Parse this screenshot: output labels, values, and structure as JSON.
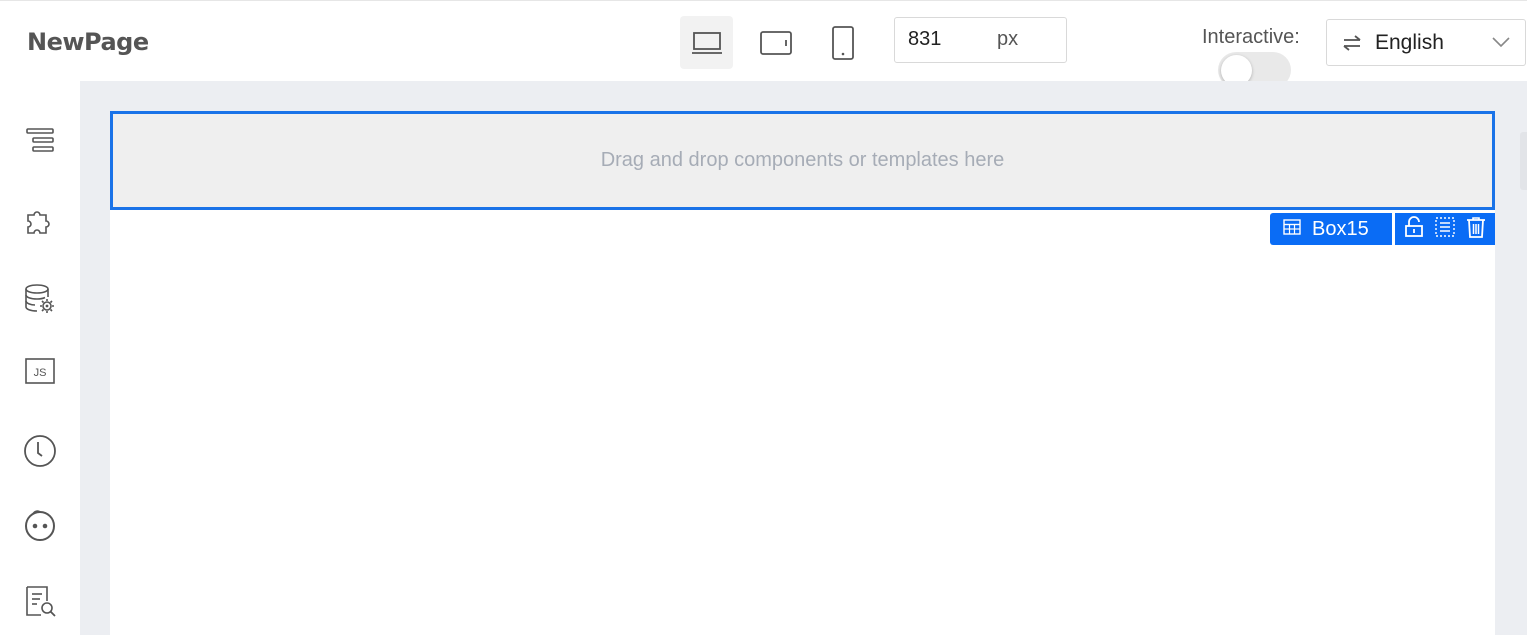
{
  "header": {
    "title": "NewPage",
    "device_modes": [
      {
        "name": "desktop",
        "icon": "laptop-icon",
        "active": true
      },
      {
        "name": "tablet",
        "icon": "tablet-icon",
        "active": false
      },
      {
        "name": "mobile",
        "icon": "phone-icon",
        "active": false
      }
    ],
    "canvas_width": {
      "value": "831",
      "unit": "px"
    },
    "interactive": {
      "label": "Interactive:",
      "enabled": false
    },
    "language": {
      "icon": "swap-icon",
      "value": "English"
    }
  },
  "sidebar": {
    "items": [
      {
        "name": "outline",
        "icon": "outline-icon"
      },
      {
        "name": "components",
        "icon": "puzzle-icon"
      },
      {
        "name": "data-source",
        "icon": "database-settings-icon"
      },
      {
        "name": "javascript",
        "icon": "js-icon"
      },
      {
        "name": "history",
        "icon": "clock-icon"
      },
      {
        "name": "ai-assistant",
        "icon": "robot-face-icon"
      },
      {
        "name": "search-code",
        "icon": "document-search-icon"
      }
    ]
  },
  "canvas": {
    "drop_placeholder": "Drag and drop components or templates here",
    "selected": {
      "label": "Box15",
      "icon": "table-icon",
      "tools": [
        "lock-icon",
        "select-parent-icon",
        "delete-icon"
      ]
    }
  },
  "colors": {
    "accent": "#1a73e8",
    "tag_blue": "#0a6cf5",
    "canvas_bg": "#eceef2",
    "icon_gray": "#555555"
  }
}
